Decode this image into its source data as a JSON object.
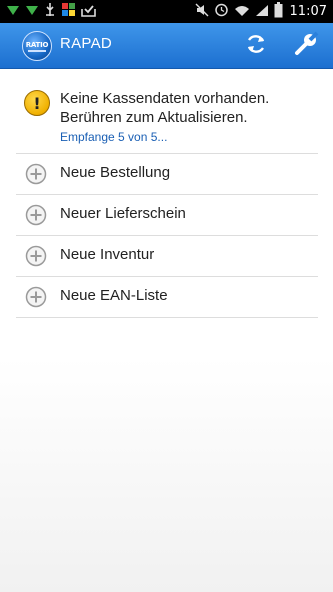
{
  "status_bar": {
    "time": "11:07",
    "left_icons": [
      "wifi-down-icon",
      "wifi-down-icon",
      "usb-icon",
      "gallery-icon",
      "download-done-icon"
    ],
    "right_icons": [
      "mute-icon",
      "alarm-icon",
      "wifi-icon",
      "signal-icon",
      "battery-icon"
    ]
  },
  "action_bar": {
    "logo_text": "RATIO",
    "title": "RAPAD",
    "refresh_icon": "refresh-icon",
    "settings_icon": "wrench-icon",
    "color": "#2a80dc"
  },
  "warning": {
    "icon": "warning-icon",
    "line1": "Keine Kassendaten vorhanden.",
    "line2": "Berühren zum Aktualisieren.",
    "subtext": "Empfange 5 von 5..."
  },
  "menu": {
    "items": [
      {
        "label": "Neue Bestellung",
        "icon": "add-circle-icon"
      },
      {
        "label": "Neuer Lieferschein",
        "icon": "add-circle-icon"
      },
      {
        "label": "Neue Inventur",
        "icon": "add-circle-icon"
      },
      {
        "label": "Neue EAN-Liste",
        "icon": "add-circle-icon"
      }
    ]
  }
}
